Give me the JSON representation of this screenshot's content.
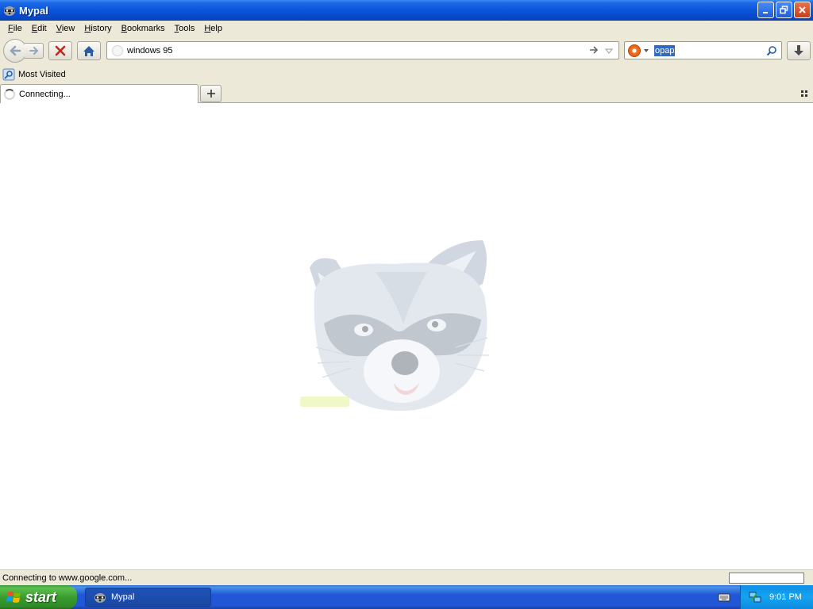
{
  "window": {
    "title": "Mypal"
  },
  "menu": [
    {
      "label": "File",
      "accel": "F",
      "rest": "ile"
    },
    {
      "label": "Edit",
      "accel": "E",
      "rest": "dit"
    },
    {
      "label": "View",
      "accel": "V",
      "rest": "iew"
    },
    {
      "label": "History",
      "accel": "H",
      "rest": "istory"
    },
    {
      "label": "Bookmarks",
      "accel": "B",
      "rest": "ookmarks"
    },
    {
      "label": "Tools",
      "accel": "T",
      "rest": "ools"
    },
    {
      "label": "Help",
      "accel": "H",
      "rest": "elp"
    }
  ],
  "navigation": {
    "url": "windows 95",
    "search_query": "opap"
  },
  "bookmarks": {
    "most_visited": "Most Visited"
  },
  "tabs": [
    {
      "label": "Connecting..."
    }
  ],
  "status": {
    "text": "Connecting to www.google.com..."
  },
  "taskbar": {
    "start_label": "start",
    "items": [
      {
        "label": "Mypal"
      }
    ],
    "clock": "9:01 PM"
  },
  "colors": {
    "titlebar": "#0a55dc",
    "chrome": "#ece9d8",
    "taskbar": "#2157d7",
    "start": "#3a9d2f",
    "selection": "#316ac5"
  },
  "icons": {
    "app": "raccoon-icon",
    "back": "back-arrow-icon",
    "forward": "forward-arrow-icon",
    "stop": "stop-x-icon",
    "home": "home-icon",
    "go": "go-arrow-icon",
    "search_engine": "duckduckgo-icon",
    "search": "magnifier-icon",
    "download": "download-arrow-icon",
    "most_visited": "most-visited-icon",
    "tab_loading": "spinner-icon",
    "new_tab": "plus-icon",
    "all_tabs": "tab-grid-icon",
    "windows_flag": "windows-flag-icon",
    "keyboard": "keyboard-icon",
    "network": "network-icon"
  }
}
